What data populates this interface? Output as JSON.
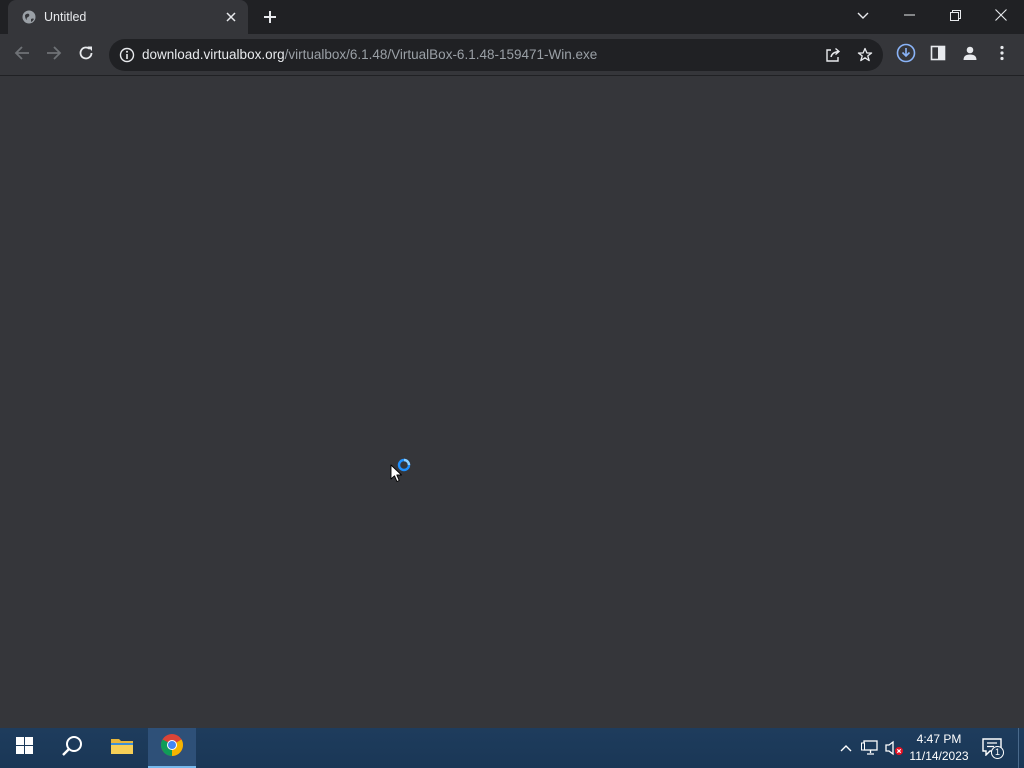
{
  "browser": {
    "tab": {
      "title": "Untitled",
      "favicon": "globe-icon"
    },
    "omnibox": {
      "host": "download.virtualbox.org",
      "path": "/virtualbox/6.1.48/VirtualBox-6.1.48-159471-Win.exe"
    }
  },
  "taskbar": {
    "clock_time": "4:47 PM",
    "clock_date": "11/14/2023",
    "notification_count": "1"
  },
  "colors": {
    "accent_download": "#8ab4f8",
    "page_background": "#35363a",
    "taskbar": "#1c3a5a"
  }
}
